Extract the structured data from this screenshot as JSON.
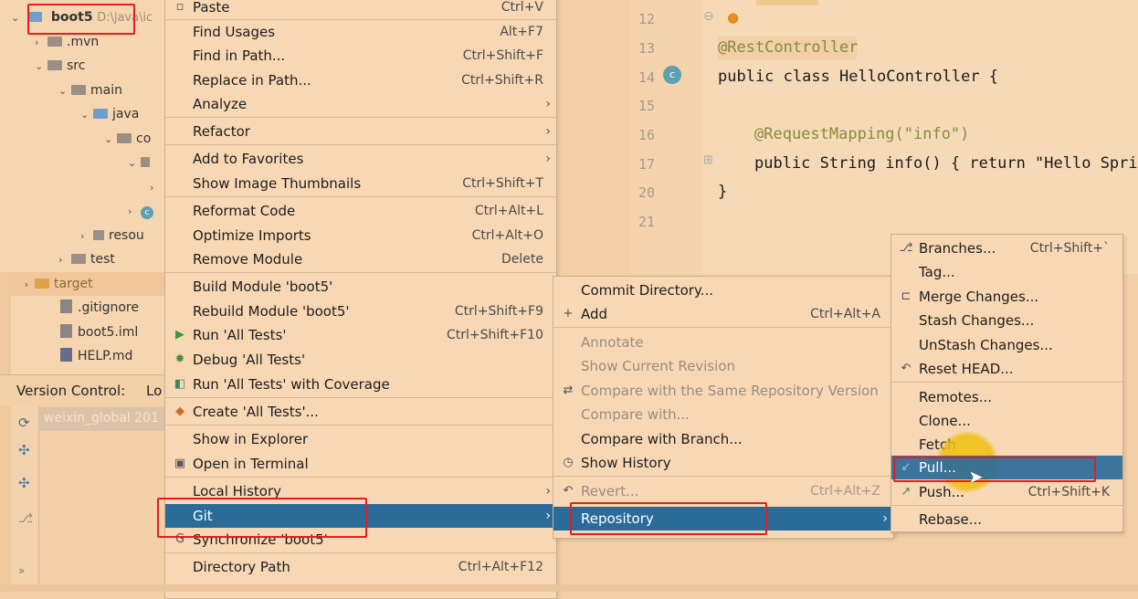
{
  "project_tree": {
    "root_name": "boot5",
    "root_path": "D:\\java\\ic",
    "items": [
      {
        "label": ".mvn"
      },
      {
        "label": "src"
      },
      {
        "label": "main"
      },
      {
        "label": "java"
      },
      {
        "label": "co"
      },
      {
        "label": "resou"
      },
      {
        "label": "test"
      },
      {
        "label": "target"
      },
      {
        "label": ".gitignore"
      },
      {
        "label": "boot5.iml"
      },
      {
        "label": "HELP.md"
      }
    ]
  },
  "version_control": {
    "title": "Version Control:",
    "tab": "Lo",
    "row": "weixin_global 201"
  },
  "editor": {
    "lines": [
      {
        "num": "12",
        "text": ""
      },
      {
        "num": "13",
        "text": "@RestController"
      },
      {
        "num": "14",
        "text": "public class HelloController {"
      },
      {
        "num": "15",
        "text": ""
      },
      {
        "num": "16",
        "text": "@RequestMapping(\"info\")"
      },
      {
        "num": "17",
        "text": "public String info() { return \"Hello Sprir"
      },
      {
        "num": "20",
        "text": "}"
      },
      {
        "num": "21",
        "text": ""
      }
    ]
  },
  "context_menu": {
    "items": [
      {
        "label": "Paste",
        "shortcut": "Ctrl+V"
      },
      {
        "label": "Find Usages",
        "shortcut": "Alt+F7"
      },
      {
        "label": "Find in Path...",
        "shortcut": "Ctrl+Shift+F"
      },
      {
        "label": "Replace in Path...",
        "shortcut": "Ctrl+Shift+R"
      },
      {
        "label": "Analyze",
        "shortcut": ""
      },
      {
        "label": "Refactor",
        "shortcut": ""
      },
      {
        "label": "Add to Favorites",
        "shortcut": ""
      },
      {
        "label": "Show Image Thumbnails",
        "shortcut": "Ctrl+Shift+T"
      },
      {
        "label": "Reformat Code",
        "shortcut": "Ctrl+Alt+L"
      },
      {
        "label": "Optimize Imports",
        "shortcut": "Ctrl+Alt+O"
      },
      {
        "label": "Remove Module",
        "shortcut": "Delete"
      },
      {
        "label": "Build Module 'boot5'",
        "shortcut": ""
      },
      {
        "label": "Rebuild Module 'boot5'",
        "shortcut": "Ctrl+Shift+F9"
      },
      {
        "label": "Run 'All Tests'",
        "shortcut": "Ctrl+Shift+F10"
      },
      {
        "label": "Debug 'All Tests'",
        "shortcut": ""
      },
      {
        "label": "Run 'All Tests' with Coverage",
        "shortcut": ""
      },
      {
        "label": "Create 'All Tests'...",
        "shortcut": ""
      },
      {
        "label": "Show in Explorer",
        "shortcut": ""
      },
      {
        "label": "Open in Terminal",
        "shortcut": ""
      },
      {
        "label": "Local History",
        "shortcut": ""
      },
      {
        "label": "Git",
        "shortcut": ""
      },
      {
        "label": "Synchronize 'boot5'",
        "shortcut": ""
      },
      {
        "label": "Directory Path",
        "shortcut": "Ctrl+Alt+F12"
      }
    ]
  },
  "git_menu": {
    "items": [
      {
        "label": "Commit Directory...",
        "shortcut": ""
      },
      {
        "label": "Add",
        "shortcut": "Ctrl+Alt+A"
      },
      {
        "label": "Annotate",
        "shortcut": ""
      },
      {
        "label": "Show Current Revision",
        "shortcut": ""
      },
      {
        "label": "Compare with the Same Repository Version",
        "shortcut": ""
      },
      {
        "label": "Compare with...",
        "shortcut": ""
      },
      {
        "label": "Compare with Branch...",
        "shortcut": ""
      },
      {
        "label": "Show History",
        "shortcut": ""
      },
      {
        "label": "Revert...",
        "shortcut": "Ctrl+Alt+Z"
      },
      {
        "label": "Repository",
        "shortcut": ""
      }
    ]
  },
  "repository_menu": {
    "items": [
      {
        "label": "Branches...",
        "shortcut": "Ctrl+Shift+`"
      },
      {
        "label": "Tag...",
        "shortcut": ""
      },
      {
        "label": "Merge Changes...",
        "shortcut": ""
      },
      {
        "label": "Stash Changes...",
        "shortcut": ""
      },
      {
        "label": "UnStash Changes...",
        "shortcut": ""
      },
      {
        "label": "Reset HEAD...",
        "shortcut": ""
      },
      {
        "label": "Remotes...",
        "shortcut": ""
      },
      {
        "label": "Clone...",
        "shortcut": ""
      },
      {
        "label": "Fetch",
        "shortcut": ""
      },
      {
        "label": "Pull...",
        "shortcut": ""
      },
      {
        "label": "Push...",
        "shortcut": "Ctrl+Shift+K"
      },
      {
        "label": "Rebase...",
        "shortcut": ""
      }
    ]
  },
  "colors": {
    "selection": "#2a6b9a",
    "highlight_box": "#e02020",
    "background": "#f4d0a8"
  }
}
